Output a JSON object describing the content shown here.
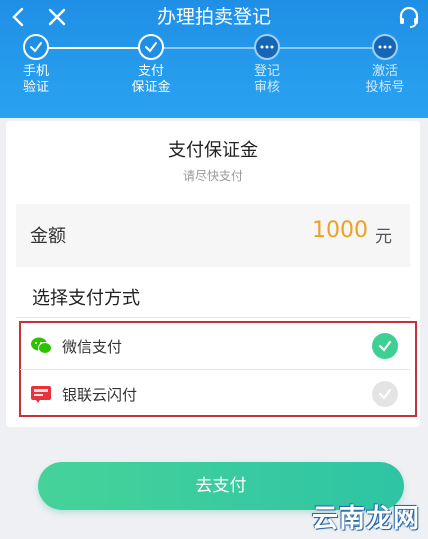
{
  "header": {
    "title": "办理拍卖登记"
  },
  "steps": [
    {
      "label_line1": "手机",
      "label_line2": "验证",
      "state": "done"
    },
    {
      "label_line1": "支付",
      "label_line2": "保证金",
      "state": "done"
    },
    {
      "label_line1": "登记",
      "label_line2": "审核",
      "state": "pending"
    },
    {
      "label_line1": "激活",
      "label_line2": "投标号",
      "state": "pending"
    }
  ],
  "card": {
    "title": "支付保证金",
    "subtitle": "请尽快支付",
    "amount_label": "金额",
    "amount_value": "1000",
    "amount_unit": "元",
    "method_heading": "选择支付方式"
  },
  "payment_methods": [
    {
      "label": "微信支付",
      "selected": true
    },
    {
      "label": "银联云闪付",
      "selected": false
    }
  ],
  "pay_button_label": "去支付",
  "watermark": "云南龙网",
  "colors": {
    "header": "#1f8fe6",
    "amount": "#f0a020",
    "selected_check": "#3fcf95",
    "highlight_border": "#c8303a",
    "button": "#3fcf95"
  }
}
